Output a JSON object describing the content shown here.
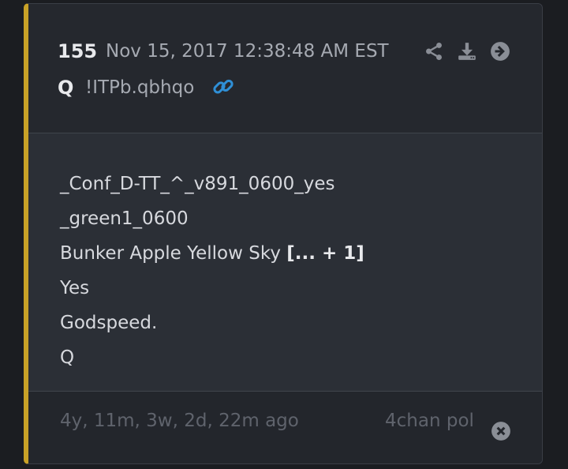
{
  "post": {
    "number": "155",
    "timestamp": "Nov 15, 2017 12:38:48 AM EST",
    "author": "Q",
    "tripcode": "!ITPb.qbhqo",
    "actions": [
      "share-icon",
      "download-icon",
      "navigate-forward-icon"
    ],
    "link_icon": "link-icon",
    "body": {
      "line1": "_Conf_D-TT_^_v891_0600_yes",
      "line2": "_green1_0600",
      "line3_text": "Bunker Apple Yellow Sky ",
      "line3_expand": "[... + 1]",
      "line4": "Yes",
      "line5": "Godspeed.",
      "line6": "Q"
    },
    "footer": {
      "relative_time": "4y, 11m, 3w, 2d, 22m ago",
      "source": "4chan pol",
      "close_icon": "close-circle-icon"
    }
  },
  "colors": {
    "accent_bar": "#c9a227",
    "link_blue": "#2f8fd6",
    "icon_gray": "#8a8e96"
  }
}
